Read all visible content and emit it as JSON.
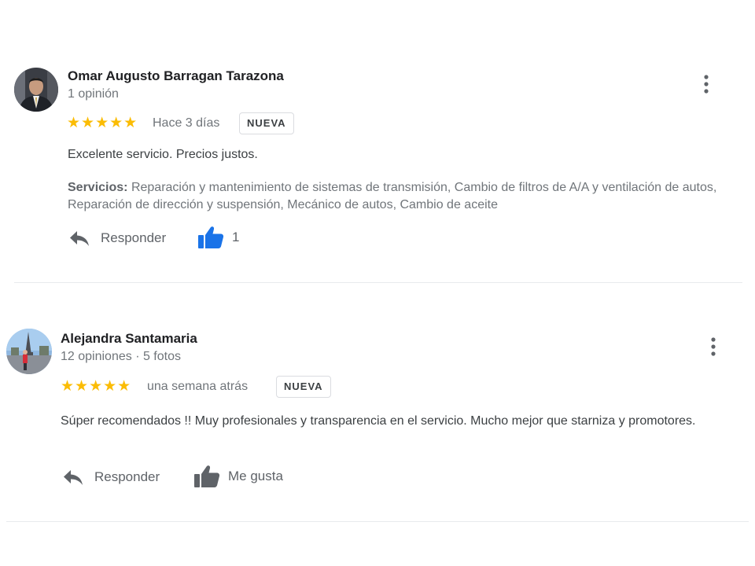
{
  "colors": {
    "star": "#fbbc04",
    "like_active": "#1a73e8",
    "icon_gray": "#5f6368",
    "divider": "#e8eaed"
  },
  "reviews": [
    {
      "author": "Omar Augusto Barragan Tarazona",
      "meta": "1 opinión",
      "stars": "★★★★★",
      "rating": 5,
      "date": "Hace 3 días",
      "badge": "NUEVA",
      "text": "Excelente servicio. Precios justos.",
      "services_label": "Servicios:",
      "services": "Reparación y mantenimiento de sistemas de transmisión, Cambio de filtros de A/A y ventilación de autos, Reparación de dirección y suspensión, Mecánico de autos, Cambio de aceite",
      "reply_label": "Responder",
      "like_label": "1",
      "like_icon": "thumbs-up-icon",
      "liked": true
    },
    {
      "author": "Alejandra Santamaria",
      "meta": "12 opiniones · 5 fotos",
      "stars": "★★★★★",
      "rating": 5,
      "date": "una semana atrás",
      "badge": "NUEVA",
      "text": "Súper recomendados !! Muy profesionales y transparencia en el servicio. Mucho mejor que starniza y promotores.",
      "reply_label": "Responder",
      "like_label": "Me gusta",
      "like_icon": "thumbs-up-icon",
      "liked": false
    }
  ]
}
